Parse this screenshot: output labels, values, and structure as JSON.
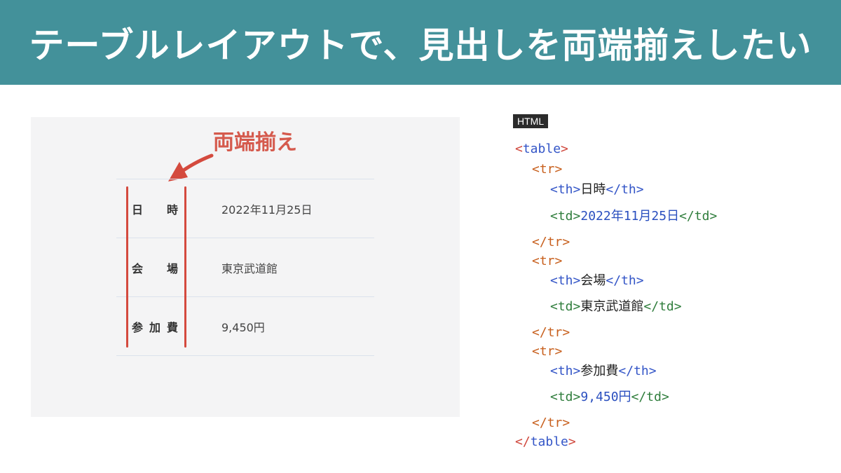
{
  "header": {
    "title": "テーブルレイアウトで、見出しを両端揃えしたい"
  },
  "preview": {
    "annotation": "両端揃え",
    "rows": [
      {
        "th": "日時",
        "td": "2022年11月25日"
      },
      {
        "th": "会場",
        "td": "東京武道館"
      },
      {
        "th": "参加費",
        "td": "9,450円"
      }
    ]
  },
  "code": {
    "badge": "HTML",
    "table_open": "table",
    "table_close": "table",
    "tr": "tr",
    "th": "th",
    "td": "td",
    "th_values": [
      "日時",
      "会場",
      "参加費"
    ],
    "td_values": [
      "2022年11月25日",
      "東京武道館",
      "9,450円"
    ]
  },
  "colors": {
    "header_bg": "#43919a",
    "annotation": "#d55a4d",
    "code_tag": "#3355c7",
    "code_bracket": "#d0483d"
  }
}
